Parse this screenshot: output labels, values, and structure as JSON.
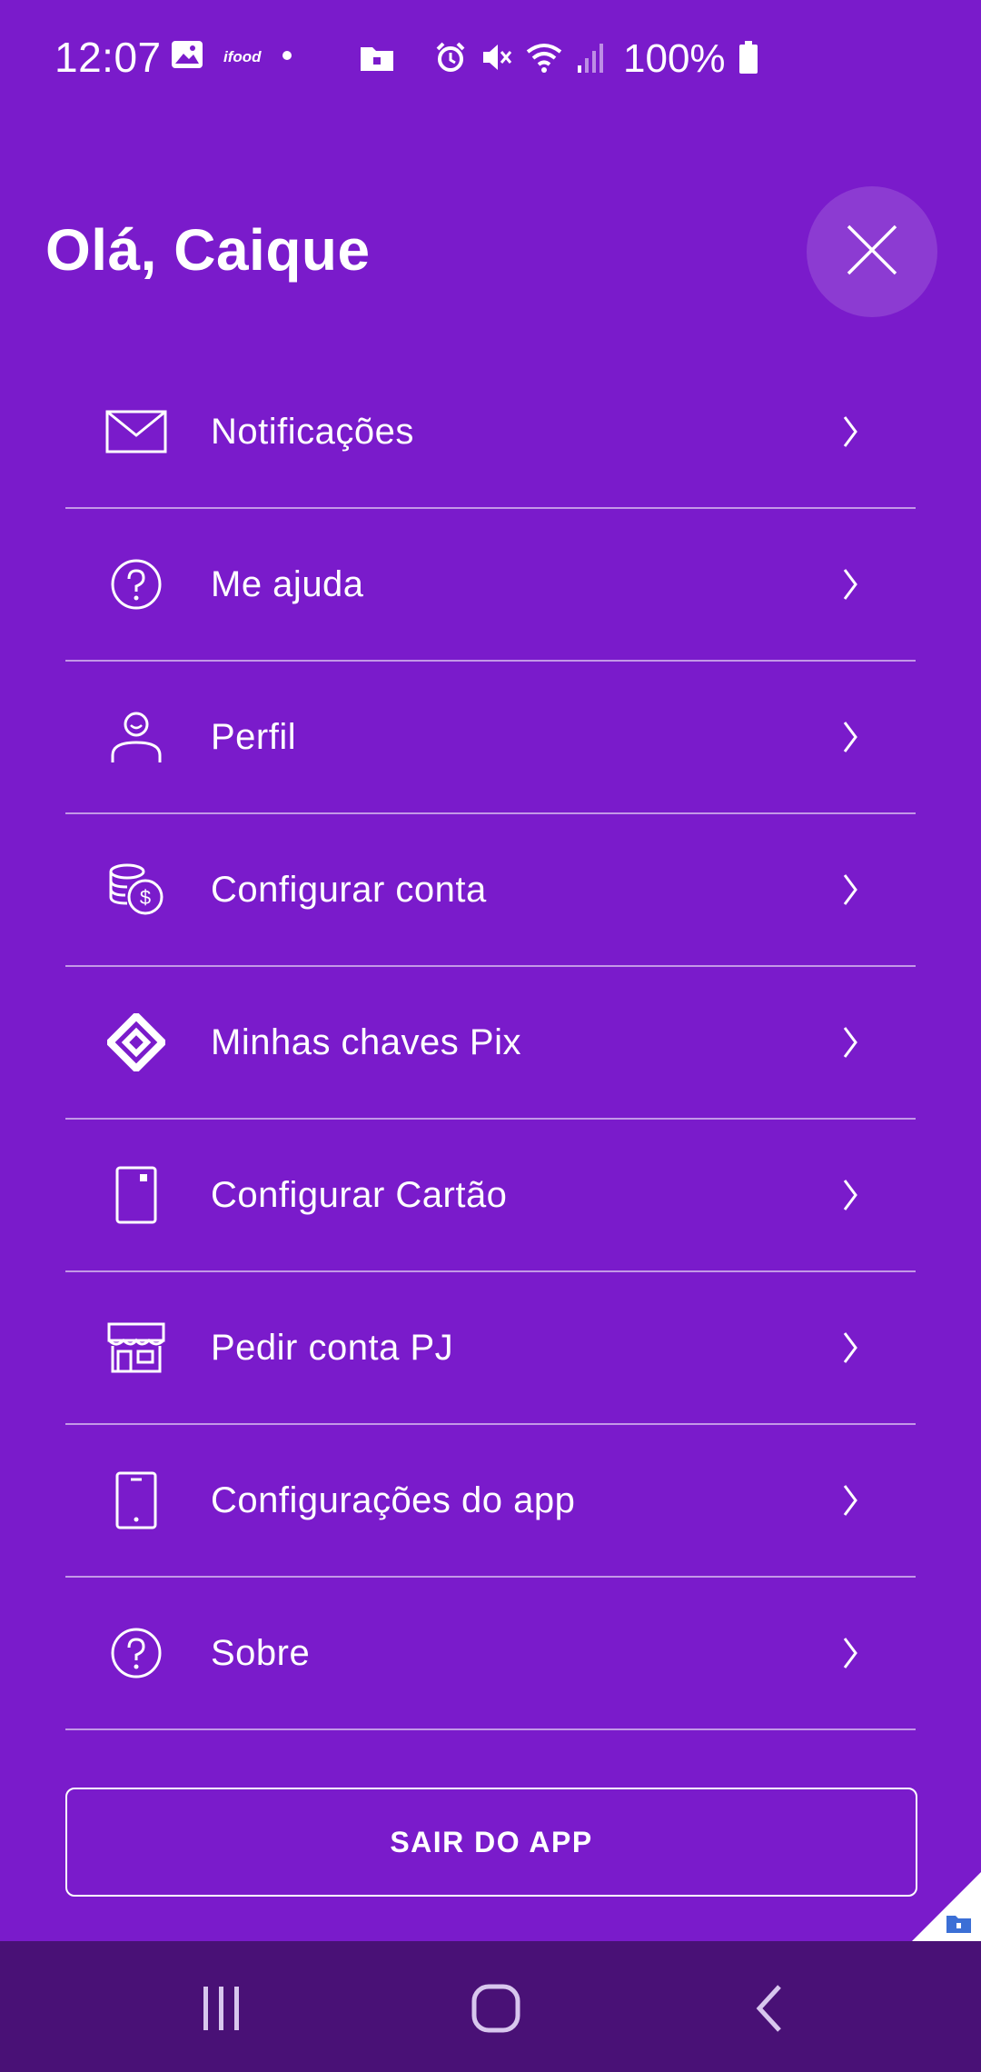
{
  "status_bar": {
    "time": "12:07",
    "battery": "100%",
    "icons": [
      "image-icon",
      "ifood-icon",
      "dot-icon",
      "secure-folder-icon",
      "alarm-icon",
      "mute-icon",
      "wifi-icon",
      "signal-icon",
      "battery-icon"
    ],
    "ifood_text": "ifood"
  },
  "header": {
    "greeting": "Olá, Caique"
  },
  "menu": {
    "items": [
      {
        "label": "Notificações",
        "icon": "envelope-icon"
      },
      {
        "label": "Me ajuda",
        "icon": "help-circle-icon"
      },
      {
        "label": "Perfil",
        "icon": "user-icon"
      },
      {
        "label": "Configurar conta",
        "icon": "coins-icon"
      },
      {
        "label": "Minhas chaves Pix",
        "icon": "pix-icon"
      },
      {
        "label": "Configurar Cartão",
        "icon": "card-icon"
      },
      {
        "label": "Pedir conta PJ",
        "icon": "store-icon"
      },
      {
        "label": "Configurações do app",
        "icon": "phone-icon"
      },
      {
        "label": "Sobre",
        "icon": "help-circle-icon"
      }
    ]
  },
  "logout_label": "SAIR DO APP",
  "colors": {
    "background": "#7A1BCB",
    "navbar": "#491176",
    "text": "#FFFFFF"
  }
}
